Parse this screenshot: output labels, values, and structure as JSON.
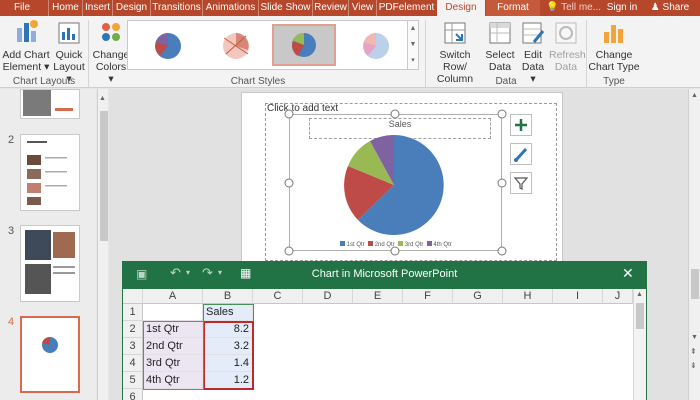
{
  "ribbon_tabs": [
    "File",
    "Home",
    "Insert",
    "Design",
    "Transitions",
    "Animations",
    "Slide Show",
    "Review",
    "View",
    "PDFelement",
    "Design",
    "Format"
  ],
  "tell_me": "Tell me...",
  "sign_in": "Sign in",
  "share": "Share",
  "ribbon": {
    "add_chart_element": [
      "Add Chart",
      "Element"
    ],
    "quick_layout": [
      "Quick",
      "Layout"
    ],
    "change_colors": [
      "Change",
      "Colors"
    ],
    "switch_row_column": [
      "Switch Row/",
      "Column"
    ],
    "select_data": [
      "Select",
      "Data"
    ],
    "edit_data": [
      "Edit",
      "Data"
    ],
    "refresh_data": [
      "Refresh",
      "Data"
    ],
    "change_chart_type": [
      "Change",
      "Chart Type"
    ],
    "groups": {
      "chart_layouts": "Chart Layouts",
      "chart_styles": "Chart Styles",
      "data": "Data",
      "type": "Type"
    }
  },
  "slides": {
    "numbers": [
      "2",
      "3",
      "4"
    ],
    "active": "4"
  },
  "chart": {
    "placeholder": "Click to add text",
    "title": "Sales",
    "legend": [
      "1st Qtr",
      "2nd Qtr",
      "3rd Qtr",
      "4th Qtr"
    ],
    "colors": [
      "#4a7ebb",
      "#be4b48",
      "#98b954",
      "#7e62a1"
    ]
  },
  "excel": {
    "title": "Chart in Microsoft PowerPoint",
    "columns": [
      "A",
      "B",
      "C",
      "D",
      "E",
      "F",
      "G",
      "H",
      "I",
      "J"
    ],
    "rows": [
      "1",
      "2",
      "3",
      "4",
      "5",
      "6"
    ],
    "header_b1": "Sales",
    "data": [
      {
        "label": "1st Qtr",
        "value": "8.2"
      },
      {
        "label": "2nd Qtr",
        "value": "3.2"
      },
      {
        "label": "3rd Qtr",
        "value": "1.4"
      },
      {
        "label": "4th Qtr",
        "value": "1.2"
      }
    ]
  }
}
